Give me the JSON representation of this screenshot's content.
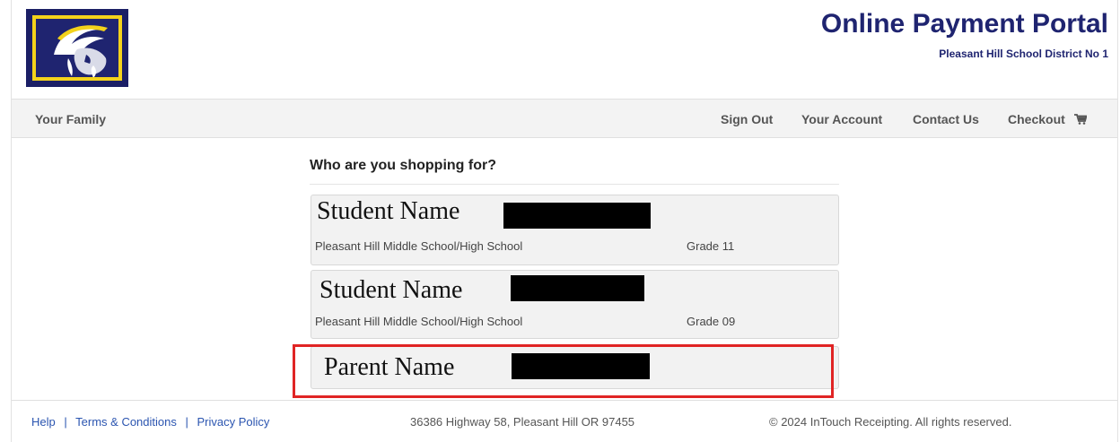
{
  "header": {
    "title": "Online Payment Portal",
    "district": "Pleasant Hill School District No 1",
    "logo_icon": "goat-mascot-icon",
    "brand_colors": {
      "navy": "#1f2470",
      "gold": "#f3d21b"
    }
  },
  "nav": {
    "family": "Your Family",
    "sign_out": "Sign Out",
    "account": "Your Account",
    "contact": "Contact Us",
    "checkout": "Checkout",
    "checkout_icon": "cart-icon"
  },
  "main": {
    "question": "Who are you shopping for?",
    "people": [
      {
        "name": "Student Name",
        "school": "Pleasant Hill Middle School/High School",
        "grade": "Grade 11"
      },
      {
        "name": "Student Name",
        "school": "Pleasant Hill Middle School/High School",
        "grade": "Grade 09"
      },
      {
        "name": "Parent Name"
      }
    ],
    "highlight_color": "#e02424"
  },
  "footer": {
    "help": "Help",
    "separator": "|",
    "terms": "Terms & Conditions",
    "privacy": "Privacy Policy",
    "address": "36386 Highway 58, Pleasant Hill OR 97455",
    "copyright": "© 2024 InTouch Receipting. All rights reserved."
  }
}
